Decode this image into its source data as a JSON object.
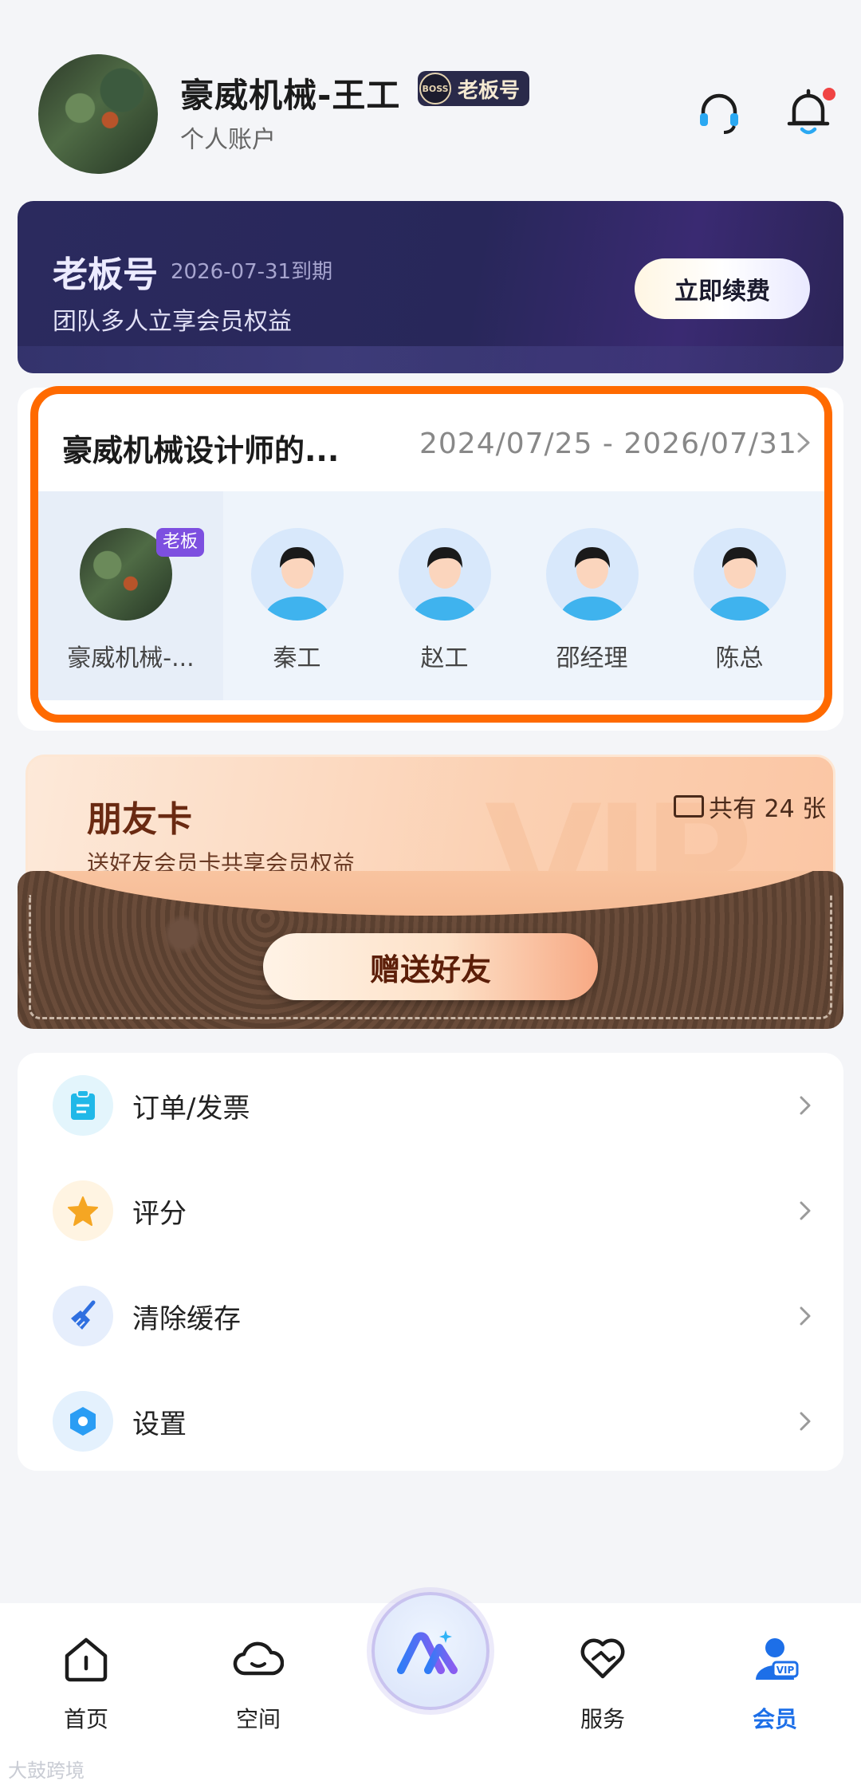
{
  "header": {
    "user_name": "豪威机械-王工",
    "badge_label": "老板号",
    "badge_icon_text": "BOSS",
    "account_type": "个人账户"
  },
  "vip_banner": {
    "title": "老板号",
    "expiry": "2026-07-31到期",
    "description": "团队多人立享会员权益",
    "renew_button": "立即续费"
  },
  "team": {
    "name": "豪威机械设计师的...",
    "date_range": "2024/07/25 - 2026/07/31",
    "boss_tag": "老板",
    "members": [
      {
        "name": "豪威机械-..."
      },
      {
        "name": "秦工"
      },
      {
        "name": "赵工"
      },
      {
        "name": "邵经理"
      },
      {
        "name": "陈总"
      }
    ]
  },
  "friend_card": {
    "title": "朋友卡",
    "description": "送好友会员卡共享会员权益",
    "count_text": "共有 24 张",
    "gift_button": "赠送好友",
    "watermark_text": "VIP"
  },
  "menu": [
    {
      "label": "订单/发票",
      "icon": "clipboard-icon",
      "color": "#20b8e8"
    },
    {
      "label": "评分",
      "icon": "star-icon",
      "color": "#f5a623"
    },
    {
      "label": "清除缓存",
      "icon": "broom-icon",
      "color": "#2f6fe0"
    },
    {
      "label": "设置",
      "icon": "hexagon-settings-icon",
      "color": "#2a9df4"
    }
  ],
  "bottom_nav": [
    {
      "label": "首页",
      "icon": "home-icon"
    },
    {
      "label": "空间",
      "icon": "cloud-icon"
    },
    {
      "label": "服务",
      "icon": "handshake-heart-icon"
    },
    {
      "label": "会员",
      "icon": "vip-user-icon",
      "active": true
    }
  ],
  "colors": {
    "accent": "#1d6fe8",
    "highlight_border": "#ff6a00",
    "vip_banner_bg": "#2b2a5e"
  },
  "watermark": "大鼓跨境"
}
